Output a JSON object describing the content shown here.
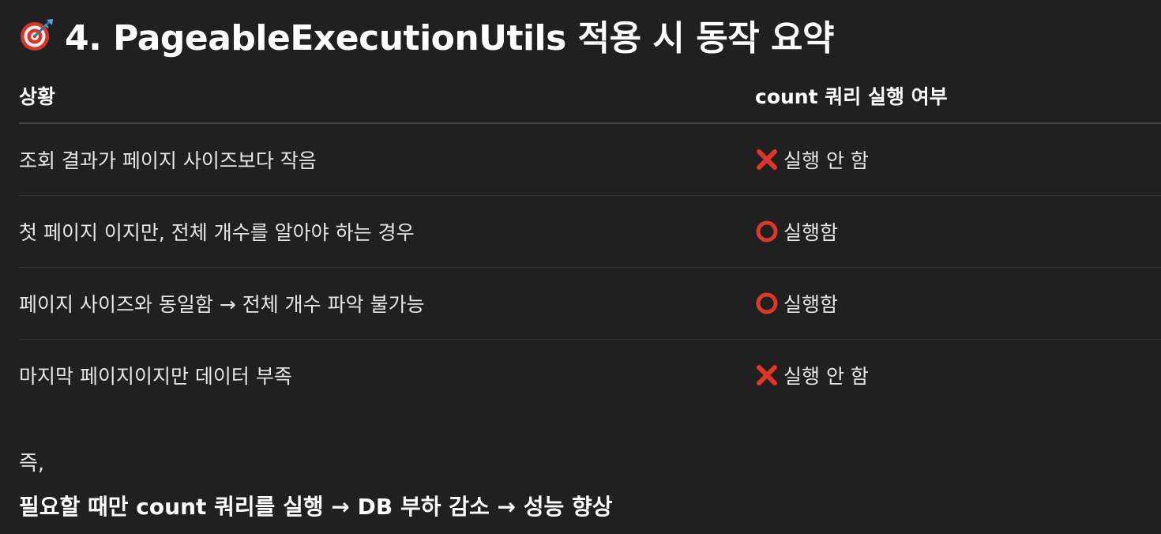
{
  "heading": {
    "icon": "dart-target-icon",
    "text": "4. PageableExecutionUtils 적용 시 동작 요약"
  },
  "table": {
    "headers": [
      "상황",
      "count 쿼리 실행 여부"
    ],
    "rows": [
      {
        "situation": "조회 결과가 페이지 사이즈보다 작음",
        "icon": "cross-mark-icon",
        "result": "실행 안 함"
      },
      {
        "situation": "첫 페이지 이지만, 전체 개수를 알아야 하는 경우",
        "icon": "circle-icon",
        "result": "실행함"
      },
      {
        "situation": "페이지 사이즈와 동일함 → 전체 개수 파악 불가능",
        "icon": "circle-icon",
        "result": "실행함"
      },
      {
        "situation": "마지막 페이지이지만 데이터 부족",
        "icon": "cross-mark-icon",
        "result": "실행 안 함"
      }
    ]
  },
  "note": "즉,",
  "summary": "필요할 때만 count 쿼리를 실행 → DB 부하 감소 → 성능 향상",
  "colors": {
    "background": "#202020",
    "cross": "#e0352b",
    "circle": "#d93a2e"
  }
}
